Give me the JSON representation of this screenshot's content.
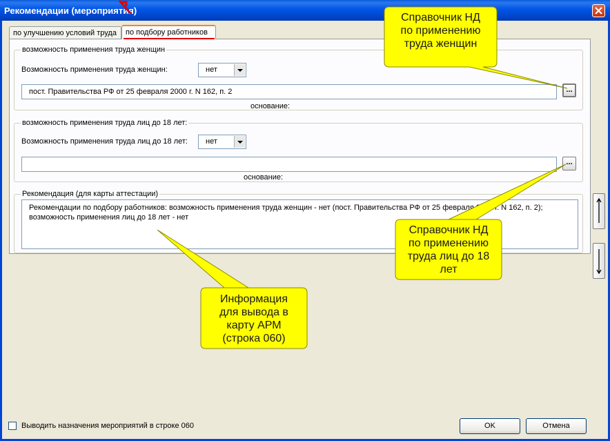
{
  "window": {
    "title": "Рекомендации (мероприятия)"
  },
  "tabs": [
    {
      "label": "по улучшению условий труда",
      "active": false
    },
    {
      "label": "по подбору работников",
      "active": true
    }
  ],
  "women_group": {
    "legend": "возможность применения труда женщин",
    "label": "Возможность применения труда женщин:",
    "combo_value": "нет",
    "basis_value": "пост. Правительства РФ от 25 февраля 2000 г. N 162, п. 2",
    "basis_label": "основание:",
    "browse_label": "..."
  },
  "minors_group": {
    "legend": "возможность применения труда лиц до 18 лет:",
    "label": "Возможность применения труда лиц до 18 лет:",
    "combo_value": "нет",
    "basis_value": "",
    "basis_label": "основание:",
    "browse_label": "..."
  },
  "recommendation_group": {
    "legend": "Рекомендация (для карты аттестации)",
    "text_line1": "Рекомендации по подбору работников: возможность применения труда женщин - нет (пост. Правительства РФ от 25 февраля 2000 г. N 162, п. 2);",
    "text_line2": "возможность применения лиц до 18 лет - нет"
  },
  "footer": {
    "checkbox_label": "Выводить назначения мероприятий в строке 060",
    "checkbox_checked": false,
    "ok_label": "OK",
    "cancel_label": "Отмена"
  },
  "callouts": {
    "women_ref": [
      "Справочник НД",
      "по применению",
      "труда женщин"
    ],
    "minors_ref": [
      "Справочник НД",
      "по применению",
      "труда лиц до 18",
      "лет"
    ],
    "arm_info": [
      "Информация",
      "для вывода в",
      "карту АРМ",
      "(строка 060)"
    ]
  },
  "colors": {
    "titlebar": "#0055e5",
    "callout_fill": "#ffff00",
    "callout_border": "#8a8a00",
    "annotation_red": "#e00000"
  }
}
